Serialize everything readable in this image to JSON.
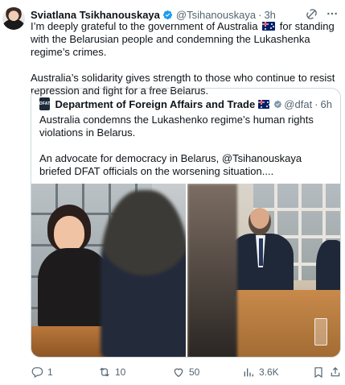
{
  "author": {
    "name": "Sviatlana Tsikhanouskaya",
    "handle": "@Tsihanouskaya",
    "time": "3h",
    "dot": "·"
  },
  "tweet": {
    "line1_before_flag": "I’m deeply grateful to the government of Australia",
    "line1_after_flag": " for standing with the Belarusian people and condemning the Lukashenka regime’s crimes.",
    "paragraph2": "Australia’s solidarity gives strength to those who continue to resist repression and fight for a free Belarus."
  },
  "quote": {
    "logo_text": "DFAT",
    "name": "Department of Foreign Affairs and Trade",
    "handle": "@dfat",
    "time": "6h",
    "dot": "·",
    "paragraph1": "Australia condemns the Lukashenko regime’s human rights violations in Belarus.",
    "paragraph2": "An advocate for democracy in Belarus, @Tsihanouskaya briefed DFAT officials on the worsening situation...."
  },
  "actions": {
    "replies": "1",
    "reposts": "10",
    "likes": "50",
    "views": "3.6K"
  },
  "colors": {
    "text_primary": "#0f1419",
    "text_secondary": "#536471",
    "verified_blue": "#1d9bf0",
    "verified_grey": "#829aab",
    "border": "#cfd9de"
  },
  "icons": {
    "grok": "grok-icon",
    "more": "more-icon",
    "reply": "reply-icon",
    "repost": "repost-icon",
    "like": "heart-icon",
    "views": "views-icon",
    "bookmark": "bookmark-icon",
    "share": "share-icon"
  }
}
